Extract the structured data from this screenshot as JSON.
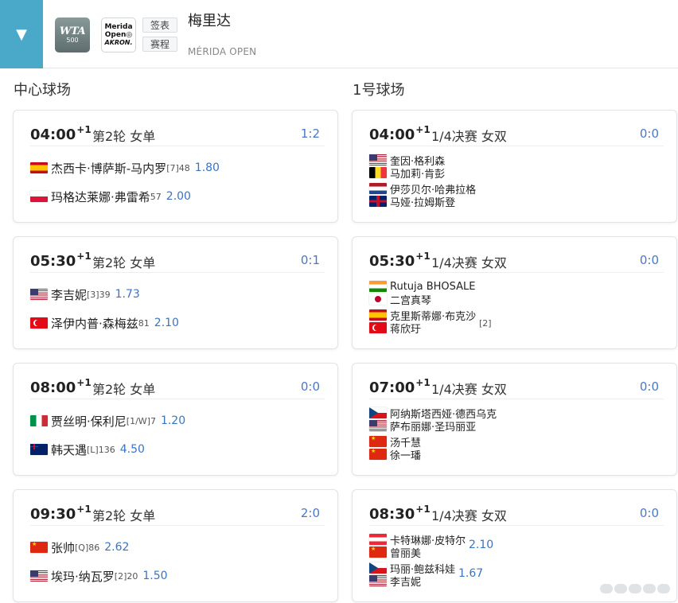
{
  "tournament": {
    "toggle_icon": "▼",
    "wta_logo_line1": "WTA",
    "wta_logo_line2": "500",
    "sponsor_logo_line1": "Merida",
    "sponsor_logo_line2": "Open◎",
    "sponsor_logo_line3": "AKRON.",
    "draw_button": "签表",
    "schedule_button": "赛程",
    "title": "梅里达",
    "subtitle": "MÉRIDA OPEN"
  },
  "courts": [
    {
      "name": "中心球场",
      "matches": [
        {
          "time": "04:00",
          "day_offset": "+1",
          "round": "第2轮 女单",
          "score": "1:2",
          "players": [
            {
              "flag": "es",
              "name": "杰西卡·博萨斯-马内罗",
              "seed": "[7]",
              "rank": "48",
              "odds": "1.80"
            },
            {
              "flag": "pl",
              "name": "玛格达莱娜·弗雷希",
              "seed": "",
              "rank": "57",
              "odds": "2.00"
            }
          ]
        },
        {
          "time": "05:30",
          "day_offset": "+1",
          "round": "第2轮 女单",
          "score": "0:1",
          "players": [
            {
              "flag": "us",
              "name": "李吉妮",
              "seed": "[3]",
              "rank": "39",
              "odds": "1.73"
            },
            {
              "flag": "tr",
              "name": "泽伊内普·森梅兹",
              "seed": "",
              "rank": "81",
              "odds": "2.10"
            }
          ]
        },
        {
          "time": "08:00",
          "day_offset": "+1",
          "round": "第2轮 女单",
          "score": "0:0",
          "players": [
            {
              "flag": "it",
              "name": "贾丝明·保利尼",
              "seed": "[1/W]",
              "rank": "7",
              "odds": "1.20"
            },
            {
              "flag": "au",
              "name": "韩天遇",
              "seed": "[L]",
              "rank": "136",
              "odds": "4.50"
            }
          ]
        },
        {
          "time": "09:30",
          "day_offset": "+1",
          "round": "第2轮 女单",
          "score": "2:0",
          "players": [
            {
              "flag": "cn",
              "name": "张帅",
              "seed": "[Q]",
              "rank": "86",
              "odds": "2.62"
            },
            {
              "flag": "us",
              "name": "埃玛·纳瓦罗",
              "seed": "[2]",
              "rank": "20",
              "odds": "1.50"
            }
          ]
        }
      ]
    },
    {
      "name": "1号球场",
      "matches": [
        {
          "time": "04:00",
          "day_offset": "+1",
          "round": "1/4决赛 女双",
          "score": "0:0",
          "teams": [
            {
              "seed": "",
              "odds": "",
              "players": [
                {
                  "flag": "us",
                  "name": "奎因·格利森"
                },
                {
                  "flag": "be",
                  "name": "马加莉·肯彭"
                }
              ]
            },
            {
              "seed": "",
              "odds": "",
              "players": [
                {
                  "flag": "nl",
                  "name": "伊莎贝尔·哈弗拉格"
                },
                {
                  "flag": "gb",
                  "name": "马娅·拉姆斯登"
                }
              ]
            }
          ]
        },
        {
          "time": "05:30",
          "day_offset": "+1",
          "round": "1/4决赛 女双",
          "score": "0:0",
          "teams": [
            {
              "seed": "",
              "odds": "",
              "players": [
                {
                  "flag": "in",
                  "name": "Rutuja BHOSALE"
                },
                {
                  "flag": "jp",
                  "name": "二宫真琴"
                }
              ]
            },
            {
              "seed": "[2]",
              "odds": "",
              "players": [
                {
                  "flag": "es",
                  "name": "克里斯蒂娜·布克沙"
                },
                {
                  "flag": "tr",
                  "name": "蒋欣玗"
                }
              ]
            }
          ]
        },
        {
          "time": "07:00",
          "day_offset": "+1",
          "round": "1/4决赛 女双",
          "score": "0:0",
          "teams": [
            {
              "seed": "",
              "odds": "",
              "players": [
                {
                  "flag": "cz",
                  "name": "阿纳斯塔西娅·德西乌克"
                },
                {
                  "flag": "us",
                  "name": "萨布丽娜·圣玛丽亚"
                }
              ]
            },
            {
              "seed": "",
              "odds": "",
              "players": [
                {
                  "flag": "cn",
                  "name": "汤千慧"
                },
                {
                  "flag": "cn",
                  "name": "徐一璠"
                }
              ]
            }
          ]
        },
        {
          "time": "08:30",
          "day_offset": "+1",
          "round": "1/4决赛 女双",
          "score": "0:0",
          "teams": [
            {
              "seed": "",
              "odds": "2.10",
              "players": [
                {
                  "flag": "at",
                  "name": "卡特琳娜·皮特尔"
                },
                {
                  "flag": "cn",
                  "name": "曾丽美"
                }
              ]
            },
            {
              "seed": "",
              "odds": "1.67",
              "players": [
                {
                  "flag": "cz",
                  "name": "玛丽·鲍兹科娃"
                },
                {
                  "flag": "us",
                  "name": "李吉妮"
                }
              ]
            }
          ]
        }
      ]
    }
  ]
}
